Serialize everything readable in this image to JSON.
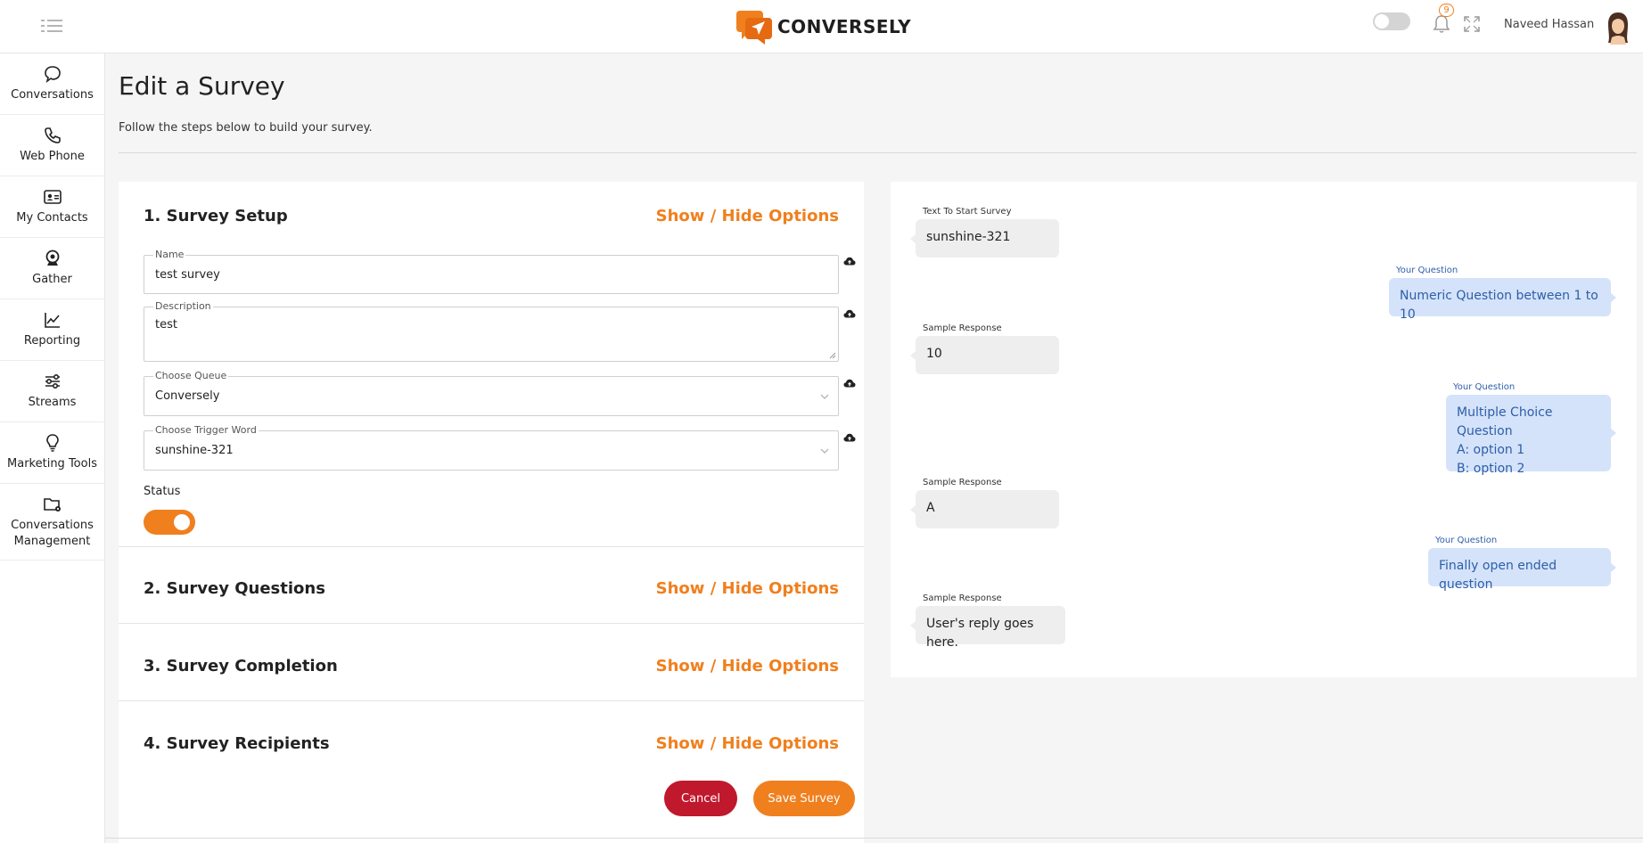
{
  "brand": {
    "name": "CONVERSELY",
    "accent": "#f07f1e",
    "danger": "#c0182c",
    "question_blue": "#2e5ea8"
  },
  "header": {
    "notifications_count": "9",
    "user_name": "Naveed Hassan",
    "dark_mode_on": false
  },
  "sidebar": {
    "items": [
      {
        "label": "Conversations",
        "icon": "chat-bubble-icon"
      },
      {
        "label": "Web Phone",
        "icon": "phone-icon"
      },
      {
        "label": "My Contacts",
        "icon": "contact-card-icon"
      },
      {
        "label": "Gather",
        "icon": "webcam-icon"
      },
      {
        "label": "Reporting",
        "icon": "line-chart-icon"
      },
      {
        "label": "Streams",
        "icon": "sliders-icon"
      },
      {
        "label": "Marketing Tools",
        "icon": "lightbulb-icon"
      },
      {
        "label": "Conversations Management",
        "label_line1": "Conversations",
        "label_line2": "Management",
        "icon": "folder-gear-icon"
      }
    ]
  },
  "page": {
    "title": "Edit a Survey",
    "subtitle": "Follow the steps below to build your survey."
  },
  "sections": [
    {
      "title": "1. Survey Setup",
      "toggle": "Show / Hide Options"
    },
    {
      "title": "2. Survey Questions",
      "toggle": "Show / Hide Options"
    },
    {
      "title": "3. Survey Completion",
      "toggle": "Show / Hide Options"
    },
    {
      "title": "4. Survey Recipients",
      "toggle": "Show / Hide Options"
    }
  ],
  "form": {
    "name": {
      "label": "Name",
      "value": "test survey"
    },
    "description": {
      "label": "Description",
      "value": "test"
    },
    "queue": {
      "label": "Choose Queue",
      "value": "Conversely"
    },
    "trigger": {
      "label": "Choose Trigger Word",
      "value": "sunshine-321"
    },
    "status": {
      "label": "Status",
      "enabled": true
    }
  },
  "actions": {
    "cancel": "Cancel",
    "save": "Save Survey"
  },
  "preview": {
    "start": {
      "label": "Text To Start Survey",
      "text": "sunshine-321"
    },
    "q1": {
      "label": "Your Question",
      "text": "Numeric Question between 1 to 10"
    },
    "r1": {
      "label": "Sample Response",
      "text": "10"
    },
    "q2": {
      "label": "Your Question",
      "line1": "Multiple Choice Question",
      "line2": "A: option 1",
      "line3": "B: option 2"
    },
    "r2": {
      "label": "Sample Response",
      "text": "A"
    },
    "q3": {
      "label": "Your Question",
      "text": "Finally open ended question"
    },
    "r3": {
      "label": "Sample Response",
      "text": "User's reply goes here."
    }
  }
}
